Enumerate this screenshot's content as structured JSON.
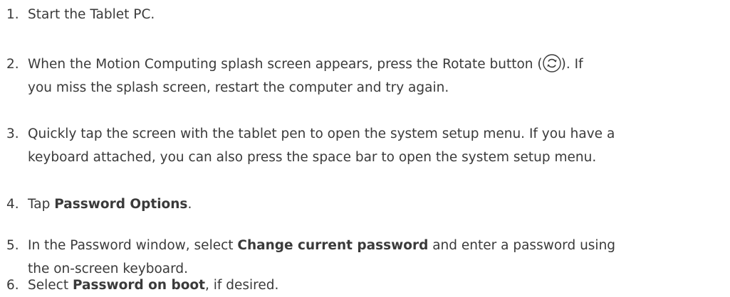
{
  "steps": [
    {
      "num": "1.",
      "text": "Start the Tablet PC."
    },
    {
      "num": "2.",
      "line1_a": "When the Motion Computing splash screen appears, press the Rotate button (",
      "icon": "rotate-icon",
      "line1_b": "). If",
      "line2": "you miss the splash screen, restart the computer and try again."
    },
    {
      "num": "3.",
      "line1": "Quickly tap the screen with the tablet pen to open the system setup menu. If you have a",
      "line2": "keyboard attached, you can also press the space bar to open the system setup menu."
    },
    {
      "num": "4.",
      "pre": "Tap ",
      "bold": "Password Options",
      "post": "."
    },
    {
      "num": "5.",
      "pre": "In the Password window, select ",
      "bold": "Change current password",
      "post": " and enter a password using",
      "line2": "the on-screen keyboard."
    },
    {
      "num": "6.",
      "pre": "Select ",
      "bold": "Password on boot",
      "post": ", if desired."
    }
  ]
}
